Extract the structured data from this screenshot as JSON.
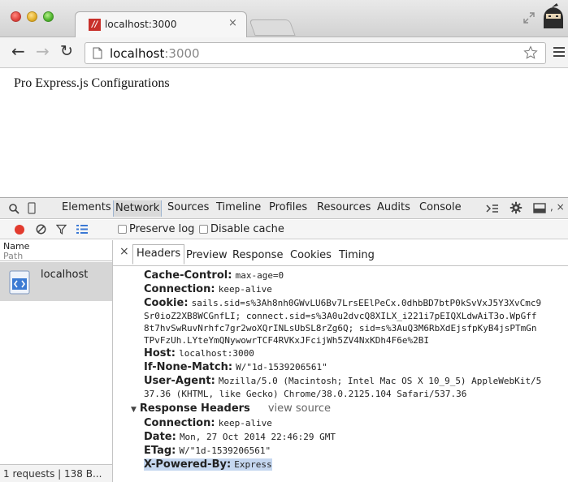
{
  "browser": {
    "tab_title": "localhost:3000",
    "tab_close": "×",
    "url_host": "localhost",
    "url_port": ":3000"
  },
  "page": {
    "heading": "Pro Express.js Configurations"
  },
  "devtools": {
    "tabs": [
      "Elements",
      "Network",
      "Sources",
      "Timeline",
      "Profiles",
      "Resources",
      "Audits",
      "Console"
    ],
    "active_tab": "Network",
    "filter": {
      "preserve_log": "Preserve log",
      "disable_cache": "Disable cache"
    },
    "columns": {
      "name": "Name",
      "path": "Path"
    },
    "request": {
      "name": "localhost"
    },
    "status": "1 requests | 138 B...",
    "detail_tabs": [
      "Headers",
      "Preview",
      "Response",
      "Cookies",
      "Timing"
    ],
    "active_detail_tab": "Headers",
    "request_headers": [
      {
        "key": "Cache-Control:",
        "value": "max-age=0"
      },
      {
        "key": "Connection:",
        "value": "keep-alive"
      },
      {
        "key": "Cookie:",
        "value": "sails.sid=s%3Ah8nh0GWvLU6Bv7LrsEElPeCx.0dhbBD7btP0kSvVxJ5Y3XvCmc9"
      },
      {
        "key": "",
        "value": "Sr0ioZ2XB8WCGnfLI; connect.sid=s%3A0u2dvcQ8XILX_i221i7pEIQXLdwAiT3o.WpGff"
      },
      {
        "key": "",
        "value": "8t7hvSwRuvNrhfc7gr2woXQrINLsUbSL8rZg6Q; sid=s%3AuQ3M6RbXdEjsfpKyB4jsPTmGn"
      },
      {
        "key": "",
        "value": "TPvFzUh.LYteYmQNywowrTCF4RVKxJFcijWh5ZV4NxKDh4F6e%2BI"
      },
      {
        "key": "Host:",
        "value": "localhost:3000"
      },
      {
        "key": "If-None-Match:",
        "value": "W/\"1d-1539206561\""
      },
      {
        "key": "User-Agent:",
        "value": "Mozilla/5.0 (Macintosh; Intel Mac OS X 10_9_5) AppleWebKit/5"
      },
      {
        "key": "",
        "value": "37.36 (KHTML, like Gecko) Chrome/38.0.2125.104 Safari/537.36"
      }
    ],
    "response_section": {
      "title": "Response Headers",
      "view_source": "view source"
    },
    "response_headers": [
      {
        "key": "Connection:",
        "value": "keep-alive"
      },
      {
        "key": "Date:",
        "value": "Mon, 27 Oct 2014 22:46:29 GMT"
      },
      {
        "key": "ETag:",
        "value": "W/\"1d-1539206561\""
      },
      {
        "key": "X-Powered-By:",
        "value": "Express"
      }
    ]
  }
}
